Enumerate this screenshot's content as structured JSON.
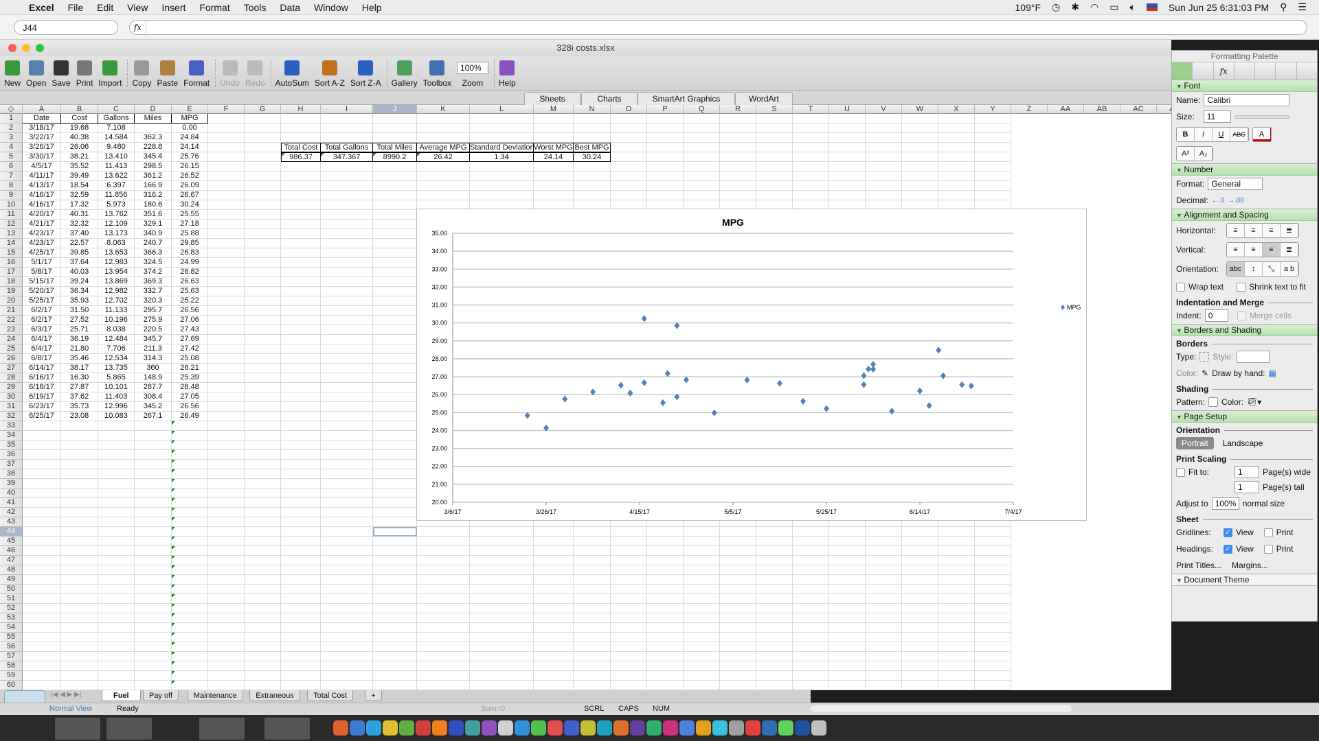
{
  "menubar": {
    "app": "Excel",
    "items": [
      "File",
      "Edit",
      "View",
      "Insert",
      "Format",
      "Tools",
      "Data",
      "Window",
      "Help"
    ],
    "temperature": "109°F",
    "datetime": "Sun Jun 25  6:31:03 PM"
  },
  "formula_bar": {
    "name_box": "J44",
    "fx": "fx",
    "formula": ""
  },
  "window": {
    "title": "328i costs.xlsx"
  },
  "toolbar": {
    "items": [
      {
        "label": "New",
        "icon": "new-icon",
        "color": "#3a9a3a"
      },
      {
        "label": "Open",
        "icon": "open-icon",
        "color": "#5a80b0"
      },
      {
        "label": "Save",
        "icon": "save-icon",
        "color": "#333333"
      },
      {
        "label": "Print",
        "icon": "print-icon",
        "color": "#777777"
      },
      {
        "label": "Import",
        "icon": "import-icon",
        "color": "#3a9a3a"
      },
      {
        "sep": true
      },
      {
        "label": "Copy",
        "icon": "copy-icon",
        "color": "#999999"
      },
      {
        "label": "Paste",
        "icon": "paste-icon",
        "color": "#b08040"
      },
      {
        "label": "Format",
        "icon": "format-brush-icon",
        "color": "#4a60c0"
      },
      {
        "sep": true
      },
      {
        "label": "Undo",
        "icon": "undo-icon",
        "color": "#bbbbbb",
        "disabled": true
      },
      {
        "label": "Redo",
        "icon": "redo-icon",
        "color": "#bbbbbb",
        "disabled": true
      },
      {
        "sep": true
      },
      {
        "label": "AutoSum",
        "icon": "autosum-icon",
        "color": "#2a60c0"
      },
      {
        "label": "Sort A-Z",
        "icon": "sort-ascending-icon",
        "color": "#c07020"
      },
      {
        "label": "Sort Z-A",
        "icon": "sort-descending-icon",
        "color": "#2a60c0"
      },
      {
        "sep": true
      },
      {
        "label": "Gallery",
        "icon": "gallery-icon",
        "color": "#50a060"
      },
      {
        "label": "Toolbox",
        "icon": "toolbox-icon",
        "color": "#4070b0"
      },
      {
        "label": "Zoom",
        "icon": "zoom-select",
        "value": "100%"
      },
      {
        "sep": true
      },
      {
        "label": "Help",
        "icon": "help-icon",
        "color": "#8a50c0"
      }
    ]
  },
  "ribbon_tabs": [
    "Sheets",
    "Charts",
    "SmartArt Graphics",
    "WordArt"
  ],
  "columns": [
    "A",
    "B",
    "C",
    "D",
    "E",
    "F",
    "G",
    "H",
    "I",
    "J",
    "K",
    "L",
    "M",
    "N",
    "O",
    "P",
    "Q",
    "R",
    "S",
    "T",
    "U",
    "V",
    "W",
    "X",
    "Y",
    "Z",
    "AA",
    "AB",
    "AC",
    "AD"
  ],
  "selected_cell": "J44",
  "fuel_table": {
    "headers": [
      "Date",
      "Cost",
      "Gallons",
      "Miles",
      "MPG"
    ],
    "rows": [
      [
        "3/18/17",
        "19.68",
        "7.108",
        "",
        "0.00"
      ],
      [
        "3/22/17",
        "40.38",
        "14.584",
        "362.3",
        "24.84"
      ],
      [
        "3/26/17",
        "26.06",
        "9.480",
        "228.8",
        "24.14"
      ],
      [
        "3/30/17",
        "38.21",
        "13.410",
        "345.4",
        "25.76"
      ],
      [
        "4/5/17",
        "35.52",
        "11.413",
        "298.5",
        "26.15"
      ],
      [
        "4/11/17",
        "39.49",
        "13.622",
        "361.2",
        "26.52"
      ],
      [
        "4/13/17",
        "18.54",
        "6.397",
        "166.9",
        "26.09"
      ],
      [
        "4/16/17",
        "32.59",
        "11.856",
        "316.2",
        "26.67"
      ],
      [
        "4/16/17",
        "17.32",
        "5.973",
        "180.6",
        "30.24"
      ],
      [
        "4/20/17",
        "40.31",
        "13.762",
        "351.6",
        "25.55"
      ],
      [
        "4/21/17",
        "32.32",
        "12.109",
        "329.1",
        "27.18"
      ],
      [
        "4/23/17",
        "37.40",
        "13.173",
        "340.9",
        "25.88"
      ],
      [
        "4/23/17",
        "22.57",
        "8.063",
        "240.7",
        "29.85"
      ],
      [
        "4/25/17",
        "39.85",
        "13.653",
        "366.3",
        "26.83"
      ],
      [
        "5/1/17",
        "37.64",
        "12.983",
        "324.5",
        "24.99"
      ],
      [
        "5/8/17",
        "40.03",
        "13.954",
        "374.2",
        "26.82"
      ],
      [
        "5/15/17",
        "39.24",
        "13.869",
        "369.3",
        "26.63"
      ],
      [
        "5/20/17",
        "36.34",
        "12.982",
        "332.7",
        "25.63"
      ],
      [
        "5/25/17",
        "35.93",
        "12.702",
        "320.3",
        "25.22"
      ],
      [
        "6/2/17",
        "31.50",
        "11.133",
        "295.7",
        "26.56"
      ],
      [
        "6/2/17",
        "27.52",
        "10.196",
        "275.9",
        "27.06"
      ],
      [
        "6/3/17",
        "25.71",
        "8.038",
        "220.5",
        "27.43"
      ],
      [
        "6/4/17",
        "36.19",
        "12.484",
        "345.7",
        "27.69"
      ],
      [
        "6/4/17",
        "21.80",
        "7.706",
        "211.3",
        "27.42"
      ],
      [
        "6/8/17",
        "35.46",
        "12.534",
        "314.3",
        "25.08"
      ],
      [
        "6/14/17",
        "38.17",
        "13.735",
        "360",
        "26.21"
      ],
      [
        "6/16/17",
        "16.30",
        "5.865",
        "148.9",
        "25.39"
      ],
      [
        "6/18/17",
        "27.87",
        "10.101",
        "287.7",
        "28.48"
      ],
      [
        "6/19/17",
        "37.62",
        "11.403",
        "308.4",
        "27.05"
      ],
      [
        "6/23/17",
        "35.73",
        "12.996",
        "345.2",
        "26.56"
      ],
      [
        "6/25/17",
        "23.08",
        "10.083",
        "267.1",
        "26.49"
      ]
    ]
  },
  "summary": {
    "headers": [
      "Total Cost",
      "Total Gallons",
      "Total Miles",
      "Average MPG",
      "Standard Deviation",
      "Worst MPG",
      "Best MPG"
    ],
    "values": [
      "986.37",
      "347.367",
      "8990.2",
      "26.42",
      "1.34",
      "24.14",
      "30.24"
    ]
  },
  "chart_data": {
    "type": "scatter",
    "title": "MPG",
    "xlabel": "",
    "ylabel": "",
    "ylim": [
      20,
      35
    ],
    "xlim": [
      "3/6/17",
      "7/4/17"
    ],
    "y_ticks": [
      "20.00",
      "21.00",
      "22.00",
      "23.00",
      "24.00",
      "25.00",
      "26.00",
      "27.00",
      "28.00",
      "29.00",
      "30.00",
      "31.00",
      "32.00",
      "33.00",
      "34.00",
      "35.00"
    ],
    "x_ticks": [
      "3/6/17",
      "3/26/17",
      "4/15/17",
      "5/5/17",
      "5/25/17",
      "6/14/17",
      "7/4/17"
    ],
    "grid": "horizontal",
    "legend": "right",
    "color": "#4f81bd",
    "series": [
      {
        "name": "MPG",
        "x": [
          "3/22/17",
          "3/26/17",
          "3/30/17",
          "4/5/17",
          "4/11/17",
          "4/13/17",
          "4/16/17",
          "4/16/17",
          "4/20/17",
          "4/21/17",
          "4/23/17",
          "4/23/17",
          "4/25/17",
          "5/1/17",
          "5/8/17",
          "5/15/17",
          "5/20/17",
          "5/25/17",
          "6/2/17",
          "6/2/17",
          "6/3/17",
          "6/4/17",
          "6/4/17",
          "6/8/17",
          "6/14/17",
          "6/16/17",
          "6/18/17",
          "6/19/17",
          "6/23/17",
          "6/25/17"
        ],
        "y": [
          24.84,
          24.14,
          25.76,
          26.15,
          26.52,
          26.09,
          26.67,
          30.24,
          25.55,
          27.18,
          25.88,
          29.85,
          26.83,
          24.99,
          26.82,
          26.63,
          25.63,
          25.22,
          26.56,
          27.06,
          27.43,
          27.69,
          27.42,
          25.08,
          26.21,
          25.39,
          28.48,
          27.05,
          26.56,
          26.49
        ]
      }
    ]
  },
  "palette": {
    "title": "Formatting Palette",
    "font": {
      "section": "Font",
      "name_label": "Name:",
      "name": "Calibri",
      "size_label": "Size:",
      "size": "11",
      "font_color": "#d00000"
    },
    "number": {
      "section": "Number",
      "format_label": "Format:",
      "format": "General",
      "decimal_label": "Decimal:"
    },
    "alignment": {
      "section": "Alignment and Spacing",
      "horizontal": "Horizontal:",
      "vertical": "Vertical:",
      "orientation": "Orientation:",
      "wrap": "Wrap text",
      "shrink": "Shrink text to fit",
      "indent_header": "Indentation and Merge",
      "indent_label": "Indent:",
      "indent": "0",
      "merge": "Merge cells"
    },
    "borders": {
      "section": "Borders and Shading",
      "borders": "Borders",
      "type": "Type:",
      "style": "Style:",
      "color": "Color:",
      "draw": "Draw by hand:",
      "shading": "Shading",
      "pattern": "Pattern:",
      "scolor": "Color:"
    },
    "page": {
      "section": "Page Setup",
      "orientation": "Orientation",
      "portrait": "Portrait",
      "landscape": "Landscape",
      "scaling": "Print Scaling",
      "fit": "Fit to:",
      "wide": "1",
      "wide_label": "Page(s) wide",
      "tall": "1",
      "tall_label": "Page(s) tall",
      "adjust": "Adjust to",
      "adjust_value": "100%",
      "normal": "normal size",
      "sheet": "Sheet",
      "gridlines": "Gridlines:",
      "headings": "Headings:",
      "view": "View",
      "print": "Print",
      "gridlines_view": true,
      "gridlines_print": false,
      "headings_view": true,
      "headings_print": false,
      "print_titles": "Print Titles...",
      "margins": "Margins..."
    },
    "theme": "Document Theme"
  },
  "sheet_tabs": [
    "Fuel",
    "Pay off",
    "Maintenance",
    "Extraneous",
    "Total Cost",
    "+"
  ],
  "active_sheet": "Fuel",
  "status": {
    "view": "Normal View",
    "state": "Ready",
    "sum": "Sum=0",
    "scrl": "SCRL",
    "caps": "CAPS",
    "num": "NUM"
  },
  "dock_colors": [
    "#e06030",
    "#3a7ad0",
    "#2aa0e0",
    "#e0c030",
    "#60b040",
    "#d04040",
    "#f08020",
    "#3050c0",
    "#40a0a0",
    "#9050c0",
    "#d0d0d0",
    "#3090e0",
    "#50c050",
    "#e05050",
    "#4060d0",
    "#c0c030",
    "#20a0c0",
    "#e07030",
    "#6040a0",
    "#30b070",
    "#d03080",
    "#5080e0",
    "#e0a020",
    "#40c0e0",
    "#a0a0a0",
    "#e04040",
    "#3070b0",
    "#60d060",
    "#2050a0",
    "#c0c0c0"
  ]
}
